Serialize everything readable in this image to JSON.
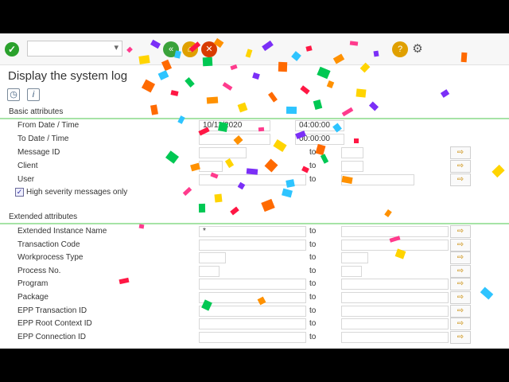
{
  "page": {
    "title": "Display the system log"
  },
  "toolbar": {
    "enter_icon": "checkmark-icon",
    "command_field_value": "",
    "buttons": [
      {
        "name": "back-icon",
        "glyph": "«",
        "color": "#3aa23a"
      },
      {
        "name": "exit-icon",
        "glyph": "⌂",
        "color": "#e0a000"
      },
      {
        "name": "cancel-icon",
        "glyph": "✕",
        "color": "#d83b01"
      },
      {
        "name": "help-icon",
        "glyph": "?",
        "color": "#e0a000"
      },
      {
        "name": "settings-icon",
        "glyph": "⚙",
        "color": "#555555"
      }
    ]
  },
  "appbar": {
    "execute_icon": "clock-execute-icon",
    "info_icon": "info-icon"
  },
  "basic": {
    "header": "Basic attributes",
    "from_label": "From Date / Time",
    "from_date": "10/11/2020",
    "from_time": "04:00:00",
    "to_label": "To Date / Time",
    "to_date": "",
    "to_time": "00:00:00",
    "msgid_label": "Message ID",
    "client_label": "Client",
    "user_label": "User",
    "to_word": "to",
    "high_severity_label": "High severity messages only",
    "high_severity_checked": true
  },
  "extended": {
    "header": "Extended attributes",
    "rows": [
      {
        "label": "Extended Instance Name",
        "value": "*"
      },
      {
        "label": "Transaction Code",
        "value": ""
      },
      {
        "label": "Workprocess Type",
        "value": ""
      },
      {
        "label": "Process No.",
        "value": ""
      },
      {
        "label": "Program",
        "value": ""
      },
      {
        "label": "Package",
        "value": ""
      },
      {
        "label": "EPP Transaction ID",
        "value": ""
      },
      {
        "label": "EPP Root Context ID",
        "value": ""
      },
      {
        "label": "EPP Connection ID",
        "value": ""
      }
    ],
    "to_word": "to"
  },
  "colors": {
    "section_line": "#a6e3a6",
    "confetti": [
      "#ff3b8d",
      "#ffd400",
      "#7b2ff7",
      "#ff6a00",
      "#2ec4ff",
      "#ff1744",
      "#00c853",
      "#ff9100"
    ]
  }
}
